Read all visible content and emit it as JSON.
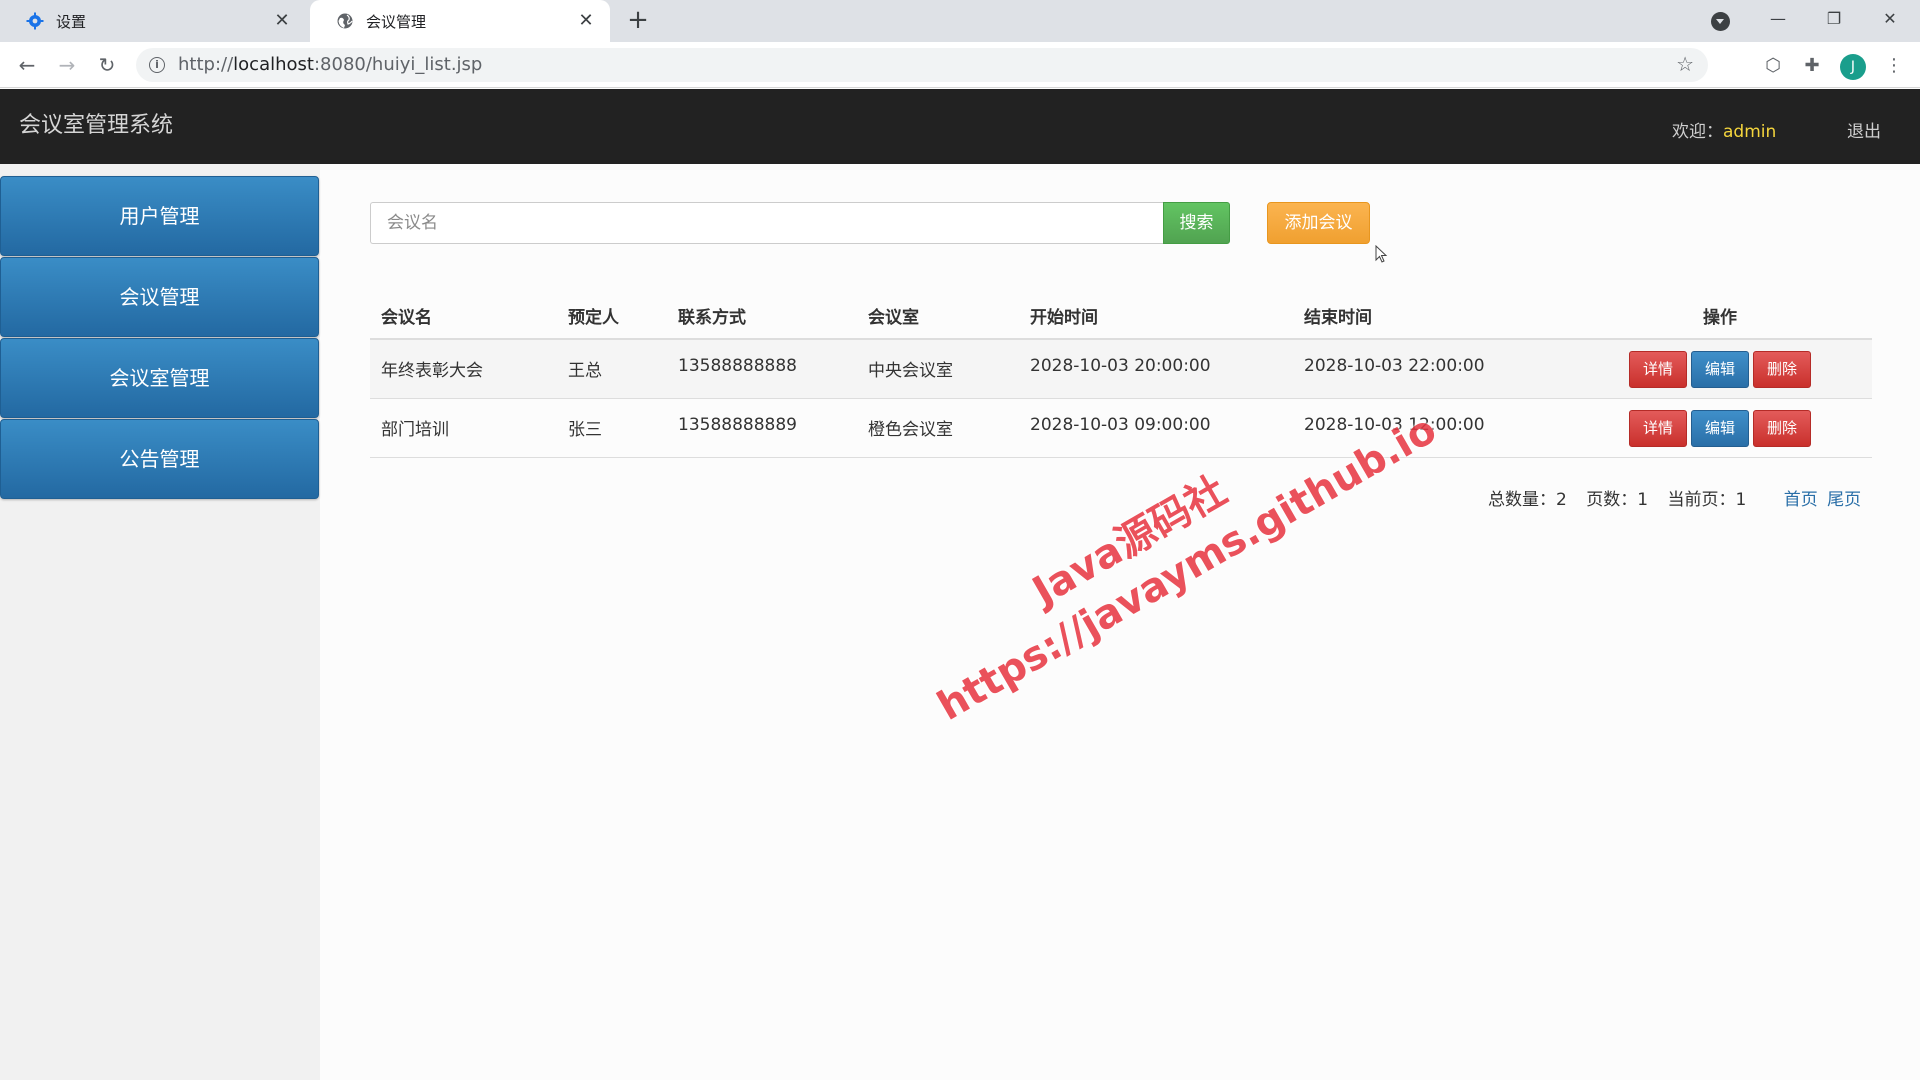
{
  "browser": {
    "tabs": [
      {
        "title": "设置",
        "icon": "gear-icon"
      },
      {
        "title": "会议管理",
        "icon": "globe-icon"
      }
    ],
    "url_prefix": "http://",
    "url_host": "localhost",
    "url_rest": ":8080/huiyi_list.jsp",
    "avatar_letter": "J"
  },
  "header": {
    "title": "会议室管理系统",
    "welcome_label": "欢迎：",
    "username": "admin",
    "logout": "退出"
  },
  "sidebar": {
    "items": [
      {
        "label": "用户管理"
      },
      {
        "label": "会议管理"
      },
      {
        "label": "会议室管理"
      },
      {
        "label": "公告管理"
      }
    ]
  },
  "search": {
    "placeholder": "会议名",
    "value": "",
    "search_label": "搜索",
    "add_label": "添加会议"
  },
  "table": {
    "columns": [
      "会议名",
      "预定人",
      "联系方式",
      "会议室",
      "开始时间",
      "结束时间",
      "操作"
    ],
    "rows": [
      [
        "年终表彰大会",
        "王总",
        "13588888888",
        "中央会议室",
        "2028-10-03 20:00:00",
        "2028-10-03 22:00:00"
      ],
      [
        "部门培训",
        "张三",
        "13588888889",
        "橙色会议室",
        "2028-10-03 09:00:00",
        "2028-10-03 12:00:00"
      ]
    ],
    "actions": {
      "detail": "详情",
      "edit": "编辑",
      "delete": "删除"
    }
  },
  "pager": {
    "total": "总数量：2",
    "pages": "页数：1",
    "current": "当前页：1",
    "first": "首页",
    "last": "尾页"
  },
  "watermark": {
    "line1": "Java源码社",
    "line2": "https://javayms.github.io"
  },
  "colors": {
    "header_bg": "#222222",
    "username": "#f5d63d",
    "sidebar_blue": "#2f7bb5",
    "search_green": "#5cb85c",
    "add_orange": "#f0ad4e",
    "danger_red": "#d9534f",
    "edit_blue": "#337ab7",
    "watermark_red": "#e8343f"
  }
}
